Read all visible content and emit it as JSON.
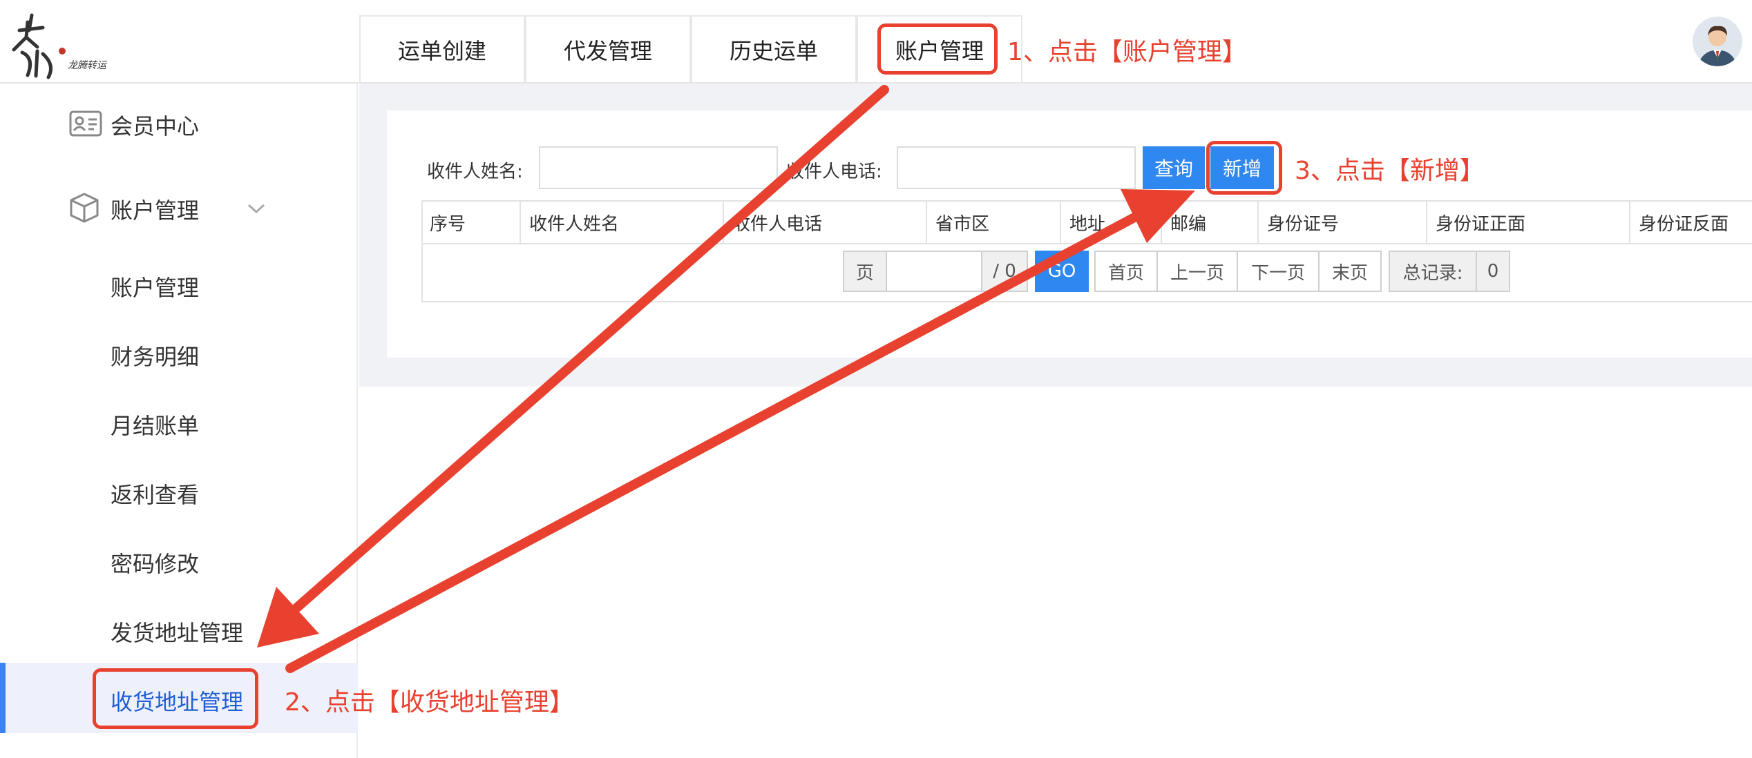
{
  "header": {
    "logo_caption": "龙腾转运",
    "tabs": [
      {
        "label": "运单创建"
      },
      {
        "label": "代发管理"
      },
      {
        "label": "历史运单"
      },
      {
        "label": "账户管理"
      }
    ]
  },
  "sidebar": {
    "member_center": "会员中心",
    "account_group": "账户管理",
    "items": [
      {
        "label": "账户管理"
      },
      {
        "label": "财务明细"
      },
      {
        "label": "月结账单"
      },
      {
        "label": "返利查看"
      },
      {
        "label": "密码修改"
      },
      {
        "label": "发货地址管理"
      },
      {
        "label": "收货地址管理"
      }
    ]
  },
  "search": {
    "name_label": "收件人姓名:",
    "name_value": "",
    "phone_label": "收件人电话:",
    "phone_value": "",
    "query_label": "查询",
    "add_label": "新增"
  },
  "table": {
    "columns": [
      "序号",
      "收件人姓名",
      "收件人电话",
      "省市区",
      "地址",
      "邮编",
      "身份证号",
      "身份证正面",
      "身份证反面"
    ]
  },
  "pagination": {
    "page_label": "页",
    "page_value": "",
    "total_pages": "/ 0",
    "go_label": "GO",
    "first": "首页",
    "prev": "上一页",
    "next": "下一页",
    "last": "末页",
    "total_label": "总记录:",
    "total_value": "0"
  },
  "annotations": {
    "step1": "1、点击【账户管理】",
    "step2": "2、点击【收货地址管理】",
    "step3": "3、点击【新增】"
  },
  "colors": {
    "accent": "#2f87f0",
    "annotation": "#e8412f",
    "active_bg": "#eef1fb"
  }
}
